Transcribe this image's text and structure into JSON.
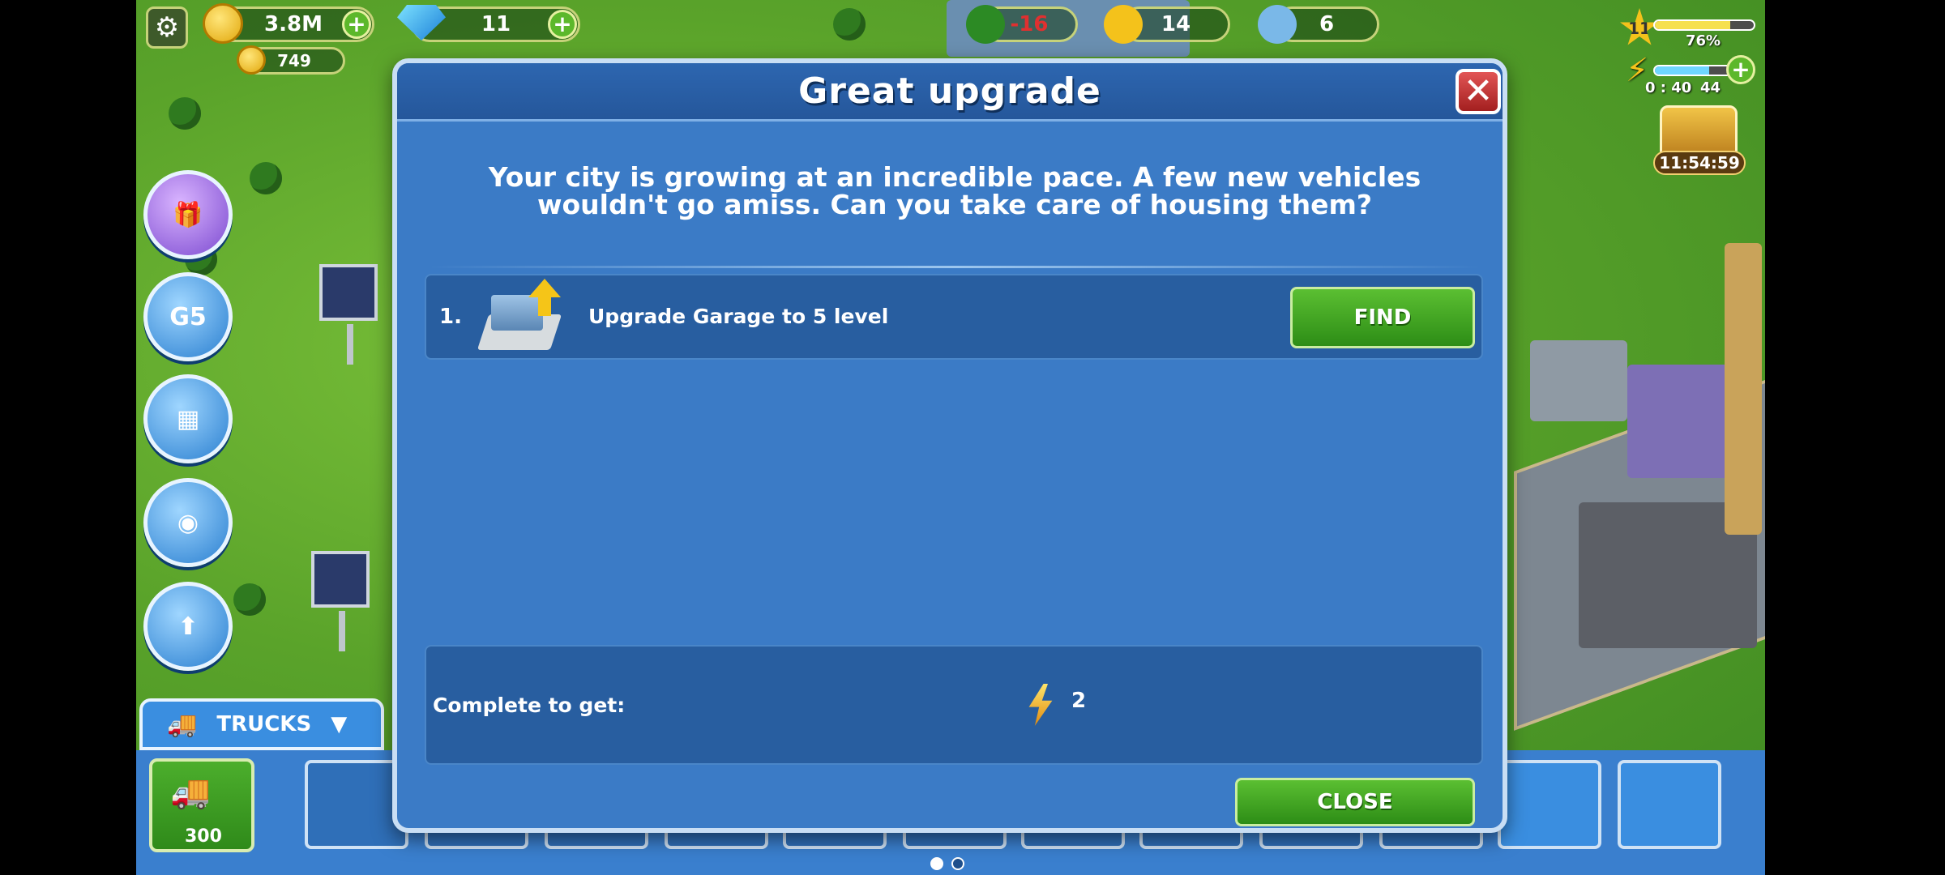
{
  "hud": {
    "coins": "3.8M",
    "vouchers": "749",
    "gems": "11",
    "ecology_value": "-16",
    "happiness": "14",
    "population": "6",
    "level": "11",
    "xp_percent_label": "76%",
    "xp_fraction": 0.76,
    "energy_timer": "0 : 40",
    "energy_count": "44",
    "energy_fraction": 0.7,
    "chest_timer": "11:54:59"
  },
  "trucks": {
    "tab_label": "TRUCKS",
    "buy_price": "300"
  },
  "dialog": {
    "title": "Great upgrade",
    "description": "Your city is growing at an incredible pace. A few new vehicles wouldn't go amiss. Can you take care of housing them?",
    "tasks": [
      {
        "number": "1.",
        "text": "Upgrade Garage to 5 level",
        "button": "FIND"
      }
    ],
    "reward_label": "Complete to get:",
    "reward_value": "2",
    "close_label": "CLOSE"
  },
  "side_buttons": {
    "g5_label": "G5"
  },
  "icons": {
    "settings": "gear-icon",
    "coins": "coin-icon",
    "gems": "gem-icon",
    "close": "close-icon",
    "reward": "lightning-icon"
  },
  "colors": {
    "dialog_bg": "#3b7bc6",
    "button_green": "#2d8d16",
    "close_red": "#a31f1f"
  }
}
